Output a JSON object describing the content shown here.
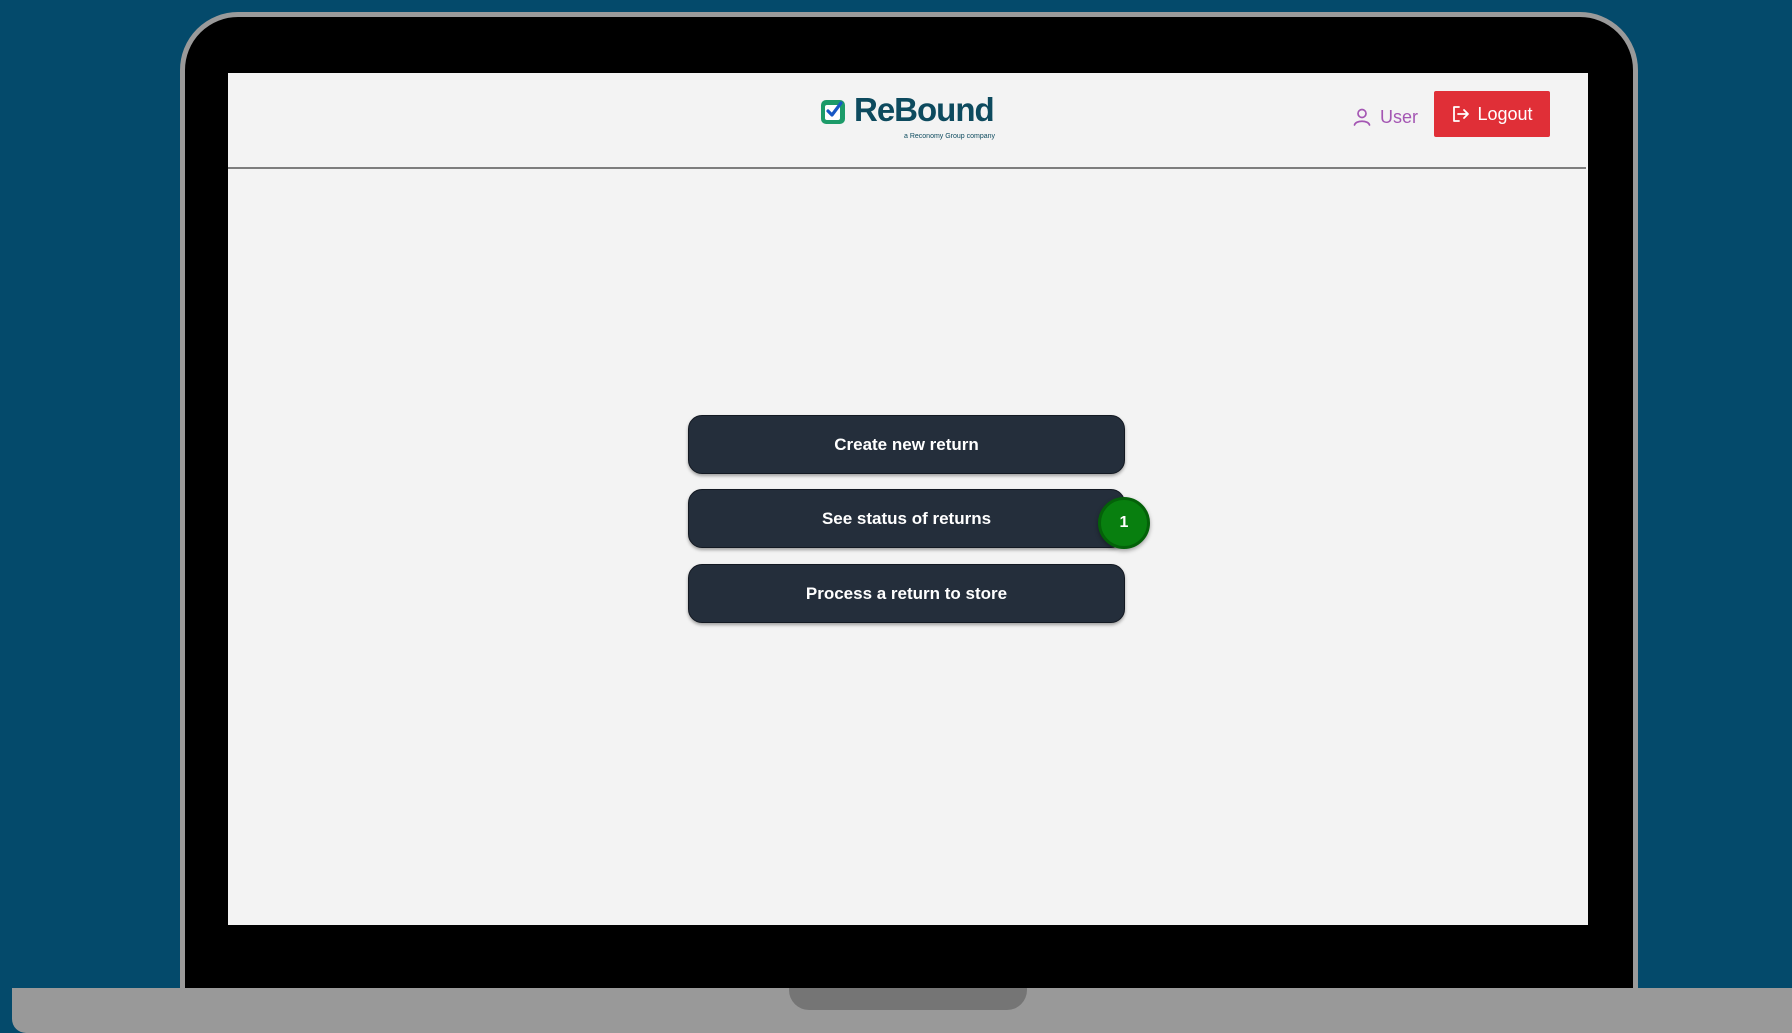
{
  "brand": {
    "name": "ReBound",
    "tagline": "a Reconomy Group company",
    "color": "#0d4a5e"
  },
  "header": {
    "user_label": "User",
    "logout_label": "Logout"
  },
  "actions": {
    "create_label": "Create new return",
    "status_label": "See status of returns",
    "status_badge": "1",
    "process_label": "Process a return to store"
  },
  "icons": {
    "user": "user-icon",
    "logout": "logout-icon",
    "logo": "rebound-logo-mark"
  },
  "colors": {
    "background": "#044a6b",
    "logout": "#e02f37",
    "button": "#242e3b",
    "badge": "#087f0f",
    "user_link": "#a456b3"
  }
}
